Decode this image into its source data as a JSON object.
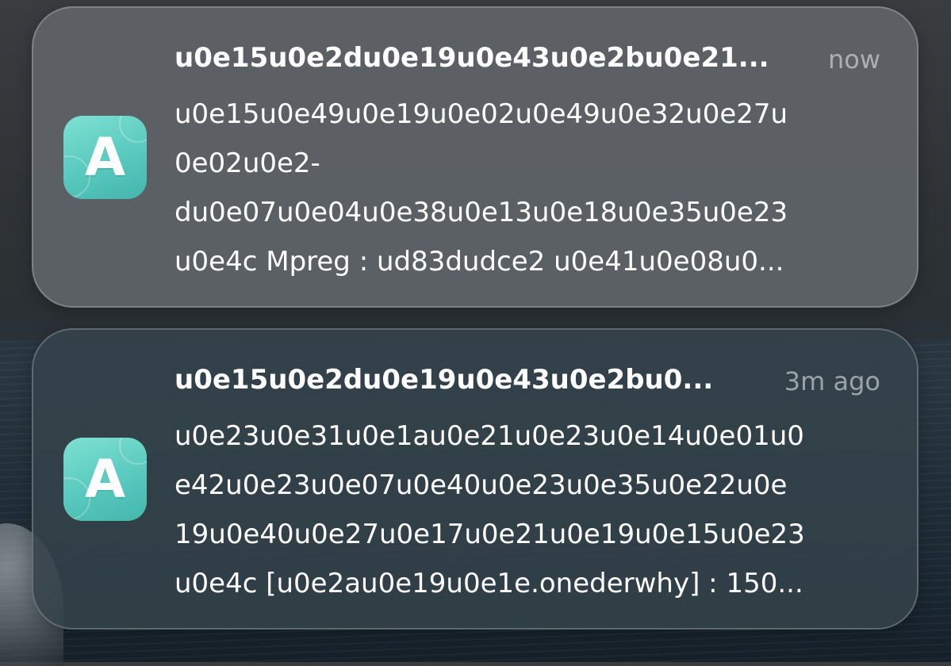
{
  "notifications": [
    {
      "app_icon": "app-icon-letter-a",
      "app_icon_letter": "A",
      "title": "u0e15u0e2du0e19u0e43u0e2bu0e21...",
      "time": "now",
      "body_lines": [
        "u0e15u0e49u0e19u0e02u0e49u0e32u0e27u",
        "0e02u0e2-",
        "du0e07u0e04u0e38u0e13u0e18u0e35u0e23",
        "u0e4c  Mpreg : ud83dudce2 u0e41u0e08u0..."
      ]
    },
    {
      "app_icon": "app-icon-letter-a",
      "app_icon_letter": "A",
      "title": "u0e15u0e2du0e19u0e43u0e2bu0...",
      "time": "3m ago",
      "body_lines": [
        "u0e23u0e31u0e1au0e21u0e23u0e14u0e01u0",
        "e42u0e23u0e07u0e40u0e23u0e35u0e22u0e",
        "19u0e40u0e27u0e17u0e21u0e19u0e15u0e23",
        "u0e4c [u0e2au0e19u0e1e.onederwhy] : 150..."
      ]
    }
  ],
  "colors": {
    "icon_accent": "#5ccbc0",
    "time_text": "#dce1e4"
  }
}
